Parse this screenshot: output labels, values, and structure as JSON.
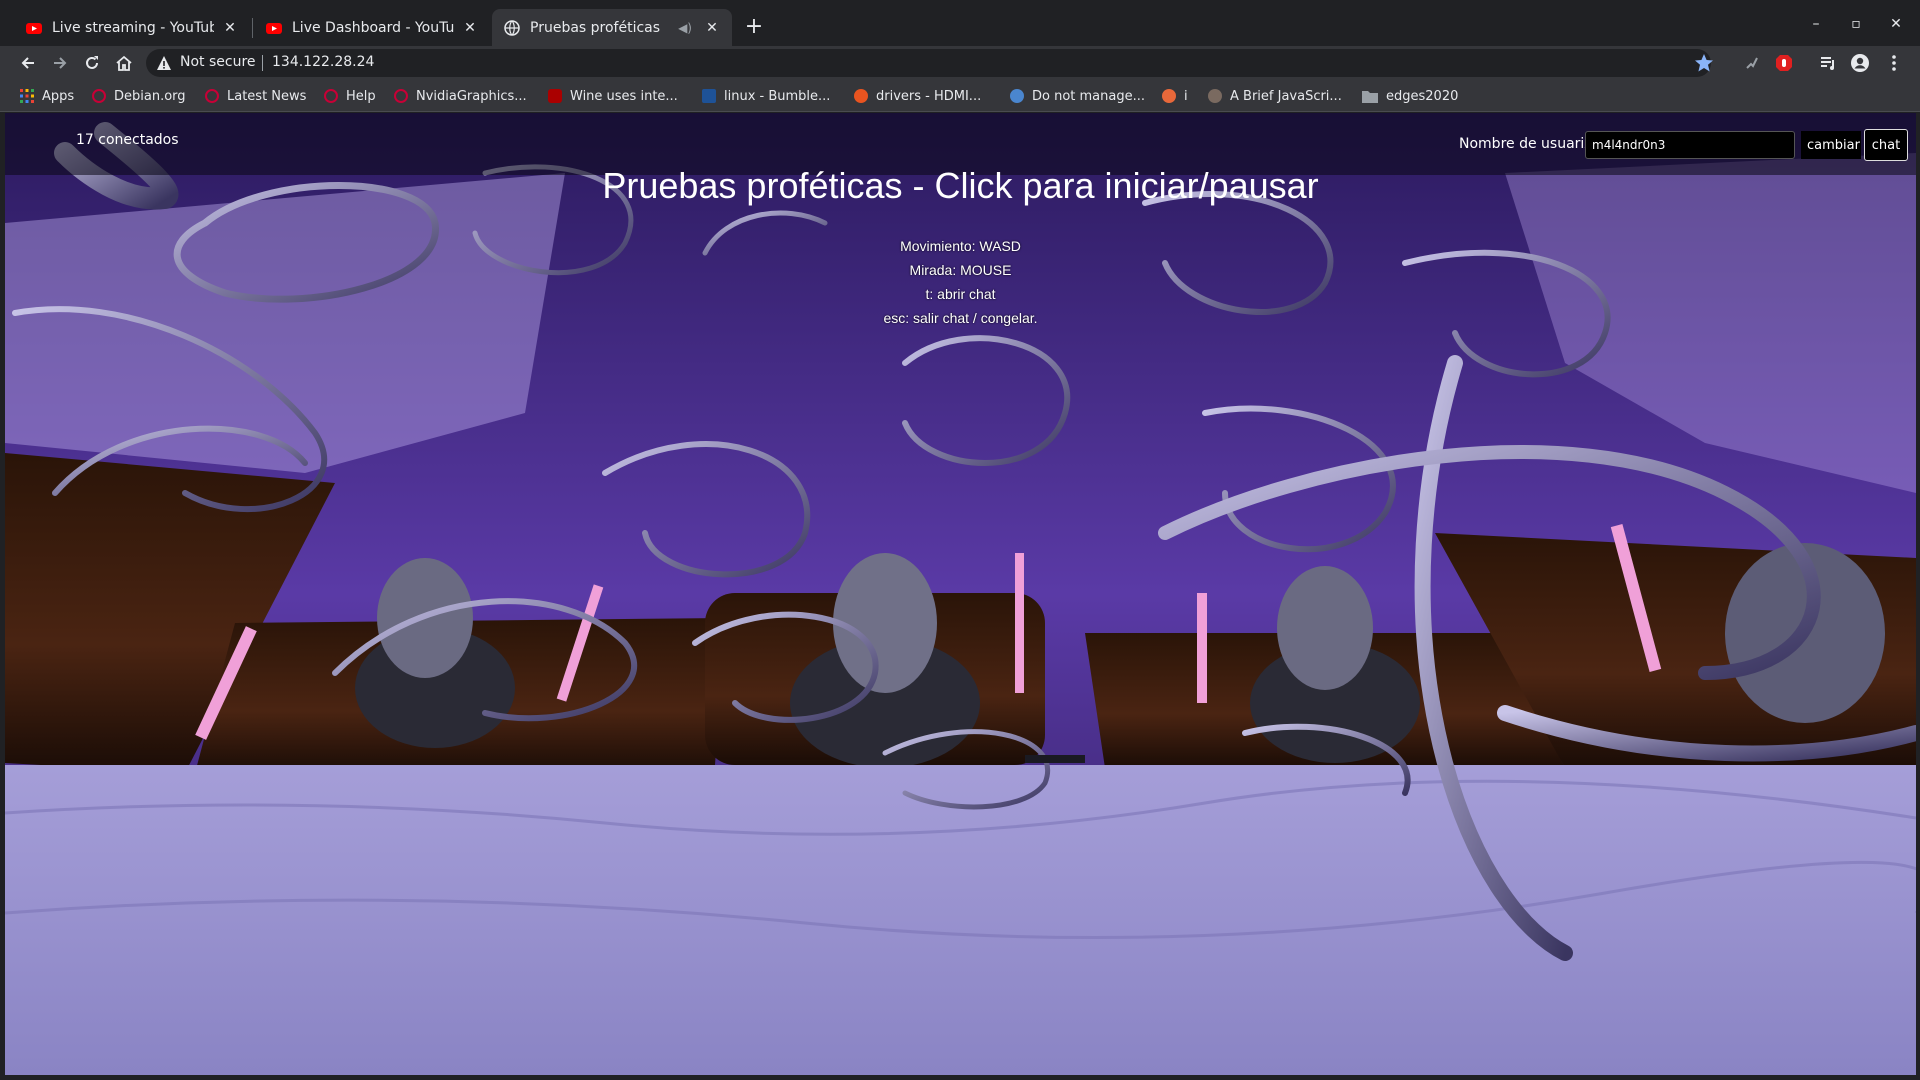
{
  "tabs": [
    {
      "title": "Live streaming - YouTube S",
      "favicon": "youtube-icon",
      "active": false
    },
    {
      "title": "Live Dashboard - YouTube",
      "favicon": "youtube-icon",
      "active": false
    },
    {
      "title": "Pruebas proféticas",
      "favicon": "globe-icon",
      "active": true
    }
  ],
  "address_bar": {
    "security_label": "Not secure",
    "url": "134.122.28.24"
  },
  "bookmarks": [
    {
      "label": "Apps",
      "icon": "apps-grid-icon"
    },
    {
      "label": "Debian.org",
      "icon": "debian-icon"
    },
    {
      "label": "Latest News",
      "icon": "debian-icon"
    },
    {
      "label": "Help",
      "icon": "debian-icon"
    },
    {
      "label": "NvidiaGraphics...",
      "icon": "debian-icon"
    },
    {
      "label": "Wine uses inte...",
      "icon": "wine-icon"
    },
    {
      "label": "linux - Bumble...",
      "icon": "stackexchange-icon"
    },
    {
      "label": "drivers - HDMI...",
      "icon": "askubuntu-icon"
    },
    {
      "label": "Do not manage...",
      "icon": "gnome-icon"
    },
    {
      "label": "i",
      "icon": "pinwheel-icon"
    },
    {
      "label": "A Brief JavaScri...",
      "icon": "site-icon"
    },
    {
      "label": "edges2020",
      "icon": "folder-icon"
    }
  ],
  "page": {
    "connected": "17 conectados",
    "username_label": "Nombre de usuarix",
    "username_value": "m4l4ndr0n3",
    "change_button": "cambiar",
    "chat_button": "chat",
    "title": "Pruebas proféticas - Click para iniciar/pausar",
    "instructions": [
      "Movimiento: WASD",
      "Mirada: MOUSE",
      "t: abrir chat",
      "esc: salir chat / congelar."
    ]
  },
  "colors": {
    "chrome_dark": "#202124",
    "chrome_toolbar": "#35363a",
    "sky_purple": "#4b2f8f",
    "floor_lavender": "#9a92cc",
    "candle_pink": "#f0a0d8"
  }
}
